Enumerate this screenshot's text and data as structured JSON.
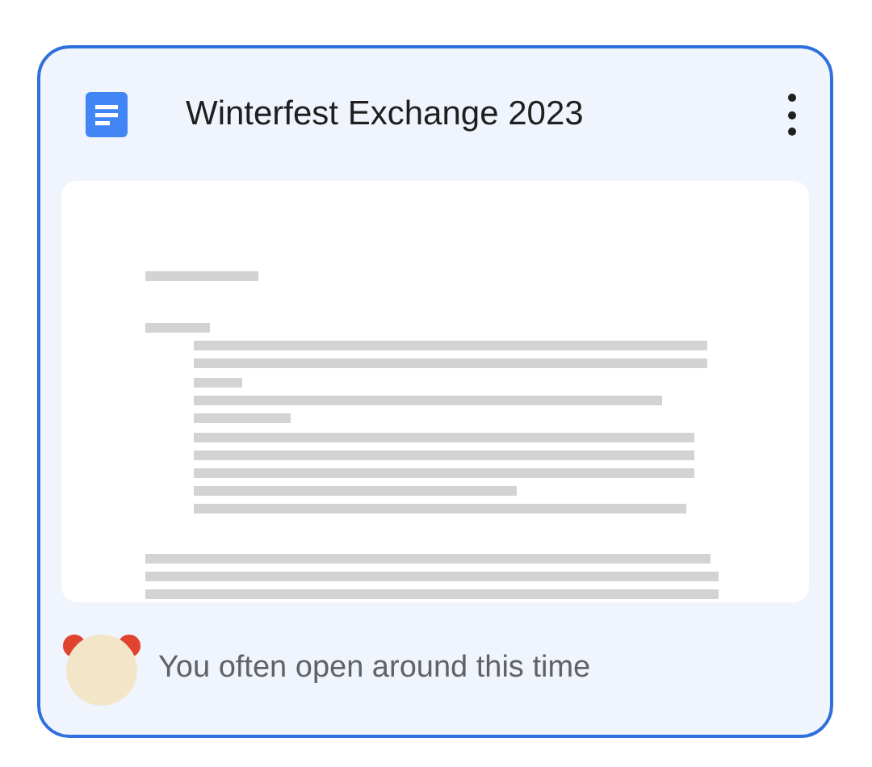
{
  "card": {
    "title": "Winterfest Exchange 2023",
    "reason": "You often open around this time",
    "selected": true
  }
}
